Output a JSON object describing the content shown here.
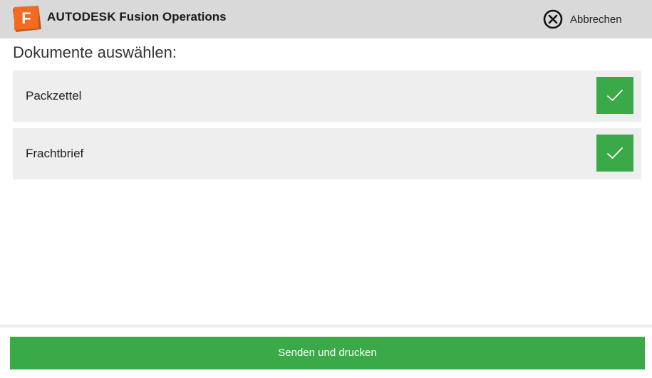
{
  "header": {
    "brand_primary": "AUTODESK",
    "brand_secondary": "Fusion Operations",
    "logo_letter": "F",
    "cancel_label": "Abbrechen"
  },
  "main": {
    "title": "Dokumente auswählen:",
    "documents": [
      {
        "label": "Packzettel",
        "selected": true
      },
      {
        "label": "Frachtbrief",
        "selected": true
      }
    ]
  },
  "footer": {
    "submit_label": "Senden und drucken"
  },
  "colors": {
    "accent_green": "#3aaa48",
    "header_bg": "#d9d9d9",
    "logo_orange": "#f26b21"
  },
  "icons": {
    "logo": "fusion-logo-icon",
    "cancel": "close-circle-icon",
    "check": "checkmark-icon"
  }
}
